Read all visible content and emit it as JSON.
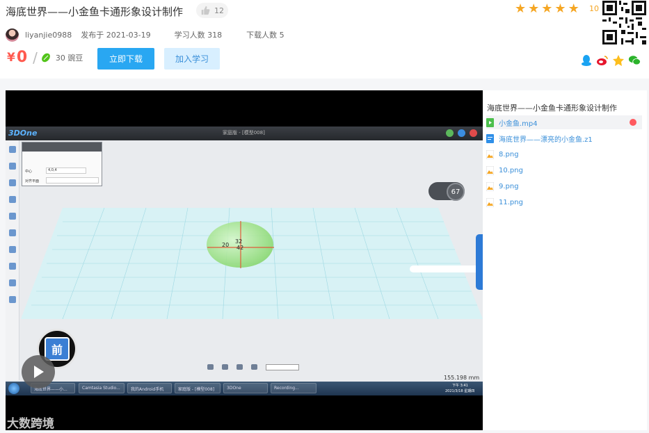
{
  "course": {
    "title": "海底世界——小金鱼卡通形象设计制作",
    "likes": "12",
    "rating_score": "10",
    "rating_stars": 5
  },
  "meta": {
    "author": "liyanjie0988",
    "published": "发布于 2021-03-19",
    "learners": "学习人数 318",
    "downloads": "下载人数 5"
  },
  "price": {
    "currency": "¥",
    "amount": "0",
    "slash": "/",
    "beans": "30 豌豆"
  },
  "actions": {
    "download": "立即下载",
    "learn": "加入学习"
  },
  "share": [
    "qq-icon",
    "weibo-icon",
    "qzone-icon",
    "wechat-icon"
  ],
  "video": {
    "app_name": "3DOne",
    "file_title": "家庭版 - [模型008]",
    "center_label": "中心",
    "center_value": "4,0,4",
    "align_label": "对齐平面",
    "dim_1": "32",
    "dim_2": "20",
    "dim_3": "42",
    "zoom": "67",
    "scale": "155.198 mm",
    "front_label": "前",
    "taskbar": [
      "海底世界——小...",
      "Camtasia Studio...",
      "我的Android手机",
      "家庭版 - [模型008]",
      "3DOne",
      "Recording..."
    ],
    "clock_time": "下午 3:41",
    "clock_date": "2021/3/18 星期四",
    "watermark": "大数跨境"
  },
  "playlist": {
    "title": "海底世界——小金鱼卡通形象设计制作",
    "items": [
      {
        "label": "小金鱼.mp4",
        "type": "video",
        "active": true
      },
      {
        "label": "海底世界——漂亮的小金鱼.z1",
        "type": "doc",
        "active": false
      },
      {
        "label": "8.png",
        "type": "image",
        "active": false
      },
      {
        "label": "10.png",
        "type": "image",
        "active": false
      },
      {
        "label": "9.png",
        "type": "image",
        "active": false
      },
      {
        "label": "11.png",
        "type": "image",
        "active": false
      }
    ]
  },
  "colors": {
    "accent": "#29a7f2",
    "price": "#ff5a4f",
    "star": "#f5a623",
    "link": "#3a8fd9"
  }
}
